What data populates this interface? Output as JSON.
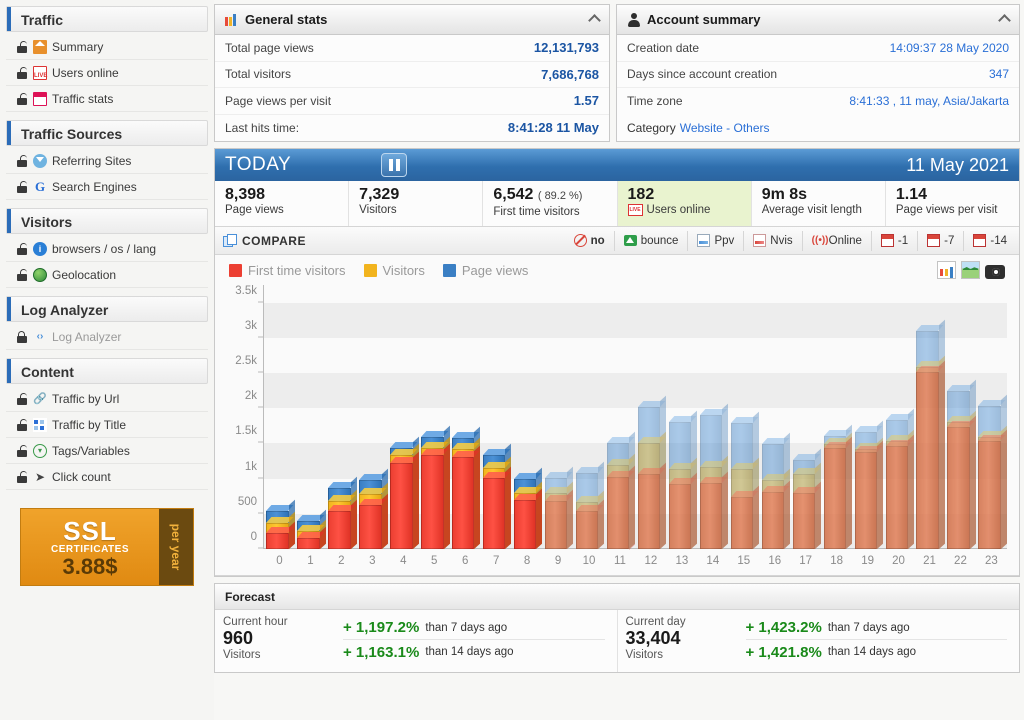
{
  "sidebar": {
    "sections": [
      {
        "title": "Traffic",
        "items": [
          {
            "label": "Summary",
            "icon": "home-icon",
            "locked": false
          },
          {
            "label": "Users online",
            "icon": "live-icon",
            "locked": false
          },
          {
            "label": "Traffic stats",
            "icon": "calendar-icon",
            "locked": false
          }
        ]
      },
      {
        "title": "Traffic Sources",
        "items": [
          {
            "label": "Referring Sites",
            "icon": "referral-icon",
            "locked": false
          },
          {
            "label": "Search Engines",
            "icon": "google-icon",
            "locked": false
          }
        ]
      },
      {
        "title": "Visitors",
        "items": [
          {
            "label": "browsers / os / lang",
            "icon": "info-icon",
            "locked": false
          },
          {
            "label": "Geolocation",
            "icon": "globe-icon",
            "locked": false
          }
        ]
      },
      {
        "title": "Log Analyzer",
        "items": [
          {
            "label": "Log Analyzer",
            "icon": "code-icon",
            "locked": true
          }
        ]
      },
      {
        "title": "Content",
        "items": [
          {
            "label": "Traffic by Url",
            "icon": "link-icon",
            "locked": false
          },
          {
            "label": "Traffic by Title",
            "icon": "grid-icon",
            "locked": false
          },
          {
            "label": "Tags/Variables",
            "icon": "tag-icon",
            "locked": false
          },
          {
            "label": "Click count",
            "icon": "cursor-icon",
            "locked": false
          }
        ]
      }
    ],
    "ad": {
      "line1": "SSL",
      "line2": "CERTIFICATES",
      "line3": "3.88$",
      "side": "per year"
    }
  },
  "general_stats": {
    "title": "General stats",
    "rows": [
      {
        "label": "Total page views",
        "value": "12,131,793"
      },
      {
        "label": "Total visitors",
        "value": "7,686,768"
      },
      {
        "label": "Page views per visit",
        "value": "1.57"
      },
      {
        "label": "Last hits time:",
        "value": "8:41:28 11 May"
      }
    ]
  },
  "account_summary": {
    "title": "Account summary",
    "rows": [
      {
        "label": "Creation date",
        "value": "14:09:37 28 May 2020"
      },
      {
        "label": "Days since account creation",
        "value": "347"
      },
      {
        "label": "Time zone",
        "value": "8:41:33 , 11 may, Asia/Jakarta"
      }
    ],
    "category_label": "Category",
    "category_link": "Website - Others"
  },
  "today": {
    "label": "TODAY",
    "date": "11 May 2021",
    "kpis": [
      {
        "value": "8,398",
        "extra": "",
        "label": "Page views",
        "highlight": false
      },
      {
        "value": "7,329",
        "extra": "",
        "label": "Visitors",
        "highlight": false
      },
      {
        "value": "6,542",
        "extra": "( 89.2 %)",
        "label": "First time visitors",
        "highlight": false
      },
      {
        "value": "182",
        "extra": "",
        "label": "Users online",
        "highlight": true,
        "live": "LIVE"
      },
      {
        "value": "9m 8s",
        "extra": "",
        "label": "Average visit length",
        "highlight": false
      },
      {
        "value": "1.14",
        "extra": "",
        "label": "Page views per visit",
        "highlight": false
      }
    ]
  },
  "compare": {
    "title": "COMPARE",
    "options": [
      {
        "label": "no",
        "icon": "no-icon",
        "active": true
      },
      {
        "label": "bounce",
        "icon": "bounce-icon",
        "active": false
      },
      {
        "label": "Ppv",
        "icon": "ppv-icon",
        "active": false
      },
      {
        "label": "Nvis",
        "icon": "nvis-icon",
        "active": false
      },
      {
        "label": "Online",
        "icon": "online-icon",
        "active": false
      },
      {
        "label": "-1",
        "icon": "calendar-icon",
        "active": false
      },
      {
        "label": "-7",
        "icon": "calendar-icon",
        "active": false
      },
      {
        "label": "-14",
        "icon": "calendar-icon",
        "active": false
      }
    ]
  },
  "chart_data": {
    "type": "bar",
    "title": "",
    "xlabel": "",
    "ylabel": "",
    "ylim": [
      0,
      3750
    ],
    "grid": true,
    "legend_position": "top-left",
    "ytick_labels": [
      "0",
      "500",
      "1k",
      "1.5k",
      "2k",
      "2.5k",
      "3k",
      "3.5k"
    ],
    "ytick_values": [
      0,
      500,
      1000,
      1500,
      2000,
      2500,
      3000,
      3500
    ],
    "categories": [
      "0",
      "1",
      "2",
      "3",
      "4",
      "5",
      "6",
      "7",
      "8",
      "9",
      "10",
      "11",
      "12",
      "13",
      "14",
      "15",
      "16",
      "17",
      "18",
      "19",
      "20",
      "21",
      "22",
      "23"
    ],
    "legend": [
      {
        "name": "First time visitors",
        "color": "#ec3f32"
      },
      {
        "name": "Visitors",
        "color": "#f2b41e"
      },
      {
        "name": "Page views",
        "color": "#3a7fc4"
      }
    ],
    "series": [
      {
        "name": "First time visitors",
        "color": "#ec3f32",
        "values": [
          230,
          150,
          540,
          620,
          1225,
          1330,
          1310,
          1010,
          690,
          680,
          540,
          1030,
          1060,
          925,
          940,
          745,
          810,
          800,
          1430,
          1375,
          1460,
          2510,
          1740,
          1540
        ]
      },
      {
        "name": "Visitors",
        "color": "#f2b41e",
        "values": [
          370,
          255,
          685,
          775,
          1330,
          1440,
          1420,
          1150,
          800,
          800,
          670,
          1200,
          1510,
          1130,
          1165,
          1130,
          985,
          1060,
          1490,
          1415,
          1540,
          2580,
          1810,
          1595
        ]
      },
      {
        "name": "Page views",
        "color": "#3a7fc4",
        "values": [
          540,
          395,
          860,
          980,
          1435,
          1590,
          1575,
          1330,
          1000,
          1010,
          1075,
          1505,
          2020,
          1810,
          1910,
          1790,
          1490,
          1265,
          1610,
          1660,
          1830,
          3100,
          2240,
          2030
        ]
      }
    ],
    "faded_from_index": 9,
    "tools": [
      "bar-chart-icon",
      "area-chart-icon",
      "camera-icon"
    ]
  },
  "forecast": {
    "title": "Forecast",
    "columns": [
      {
        "period": "Current hour",
        "value": "960",
        "unit": "Visitors",
        "lines": [
          {
            "pct": "+ 1,197.2%",
            "text": "than 7 days ago"
          },
          {
            "pct": "+ 1,163.1%",
            "text": "than 14 days ago"
          }
        ]
      },
      {
        "period": "Current day",
        "value": "33,404",
        "unit": "Visitors",
        "lines": [
          {
            "pct": "+ 1,423.2%",
            "text": "than 7 days ago"
          },
          {
            "pct": "+ 1,421.8%",
            "text": "than 14 days ago"
          }
        ]
      }
    ]
  }
}
